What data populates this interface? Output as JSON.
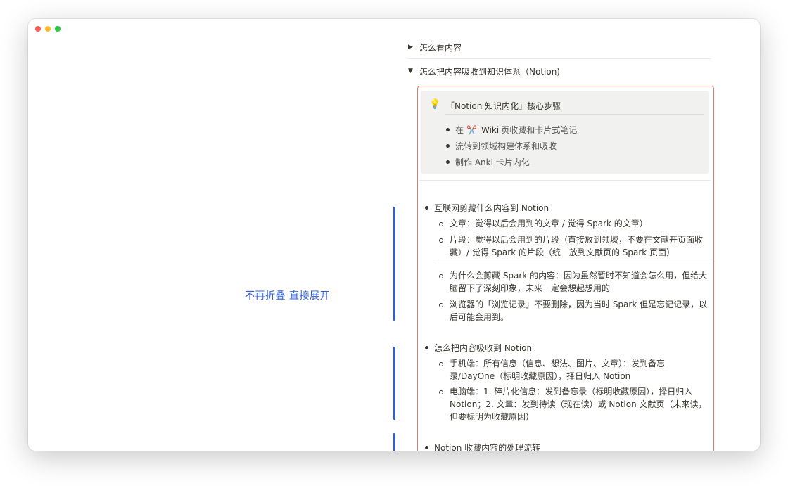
{
  "annotation": {
    "note": "不再折叠 直接展开"
  },
  "toggles": [
    {
      "label": "怎么看内容",
      "state": "collapsed"
    },
    {
      "label": "怎么把内容吸收到知识体系（Notion)",
      "state": "expanded"
    }
  ],
  "callout": {
    "icon": "💡",
    "title": "「Notion 知识内化」核心步骤",
    "items": [
      {
        "prefix": "在",
        "link_icon": "✂️",
        "link": "Wiki",
        "suffix": "页收藏和卡片式笔记"
      },
      {
        "text": "流转到领域构建体系和吸收"
      },
      {
        "text": "制作 Anki 卡片内化"
      }
    ]
  },
  "sections": [
    {
      "title": "互联网剪藏什么内容到 Notion",
      "items": [
        "文章：觉得以后会用到的文章 / 觉得 Spark 的文章）",
        "片段：觉得以后会用到的片段（直接放到领域，不要在文献开页面收藏）/ 觉得 Spark 的片段（统一放到文献页的 Spark 页面）",
        "为什么会剪藏 Spark 的内容：因为虽然暂时不知道会怎么用，但给大脑留下了深刻印象，未来一定会想起想用的",
        "浏览器的「浏览记录」不要删除，因为当时 Spark 但是忘记记录，以后可能会用到。"
      ]
    },
    {
      "title": "怎么把内容吸收到 Notion",
      "items": [
        "手机端：所有信息（信息、想法、图片、文章）：发到备忘录/DayOne（标明收藏原因），择日归入 Notion",
        "电脑端：1. 碎片化信息：发到备忘录（标明收藏原因），择日归入 Notion；2. 文章：发到待读（现在读）或 Notion 文献页（未来读，但要标明为收藏原因）"
      ]
    },
    {
      "title": "Notion 收藏内容的处理流转",
      "items": []
    }
  ],
  "colors": {
    "accent_blue": "#2f5fd7",
    "highlight_border": "#e0786a",
    "callout_bg": "#f1f1ef"
  }
}
